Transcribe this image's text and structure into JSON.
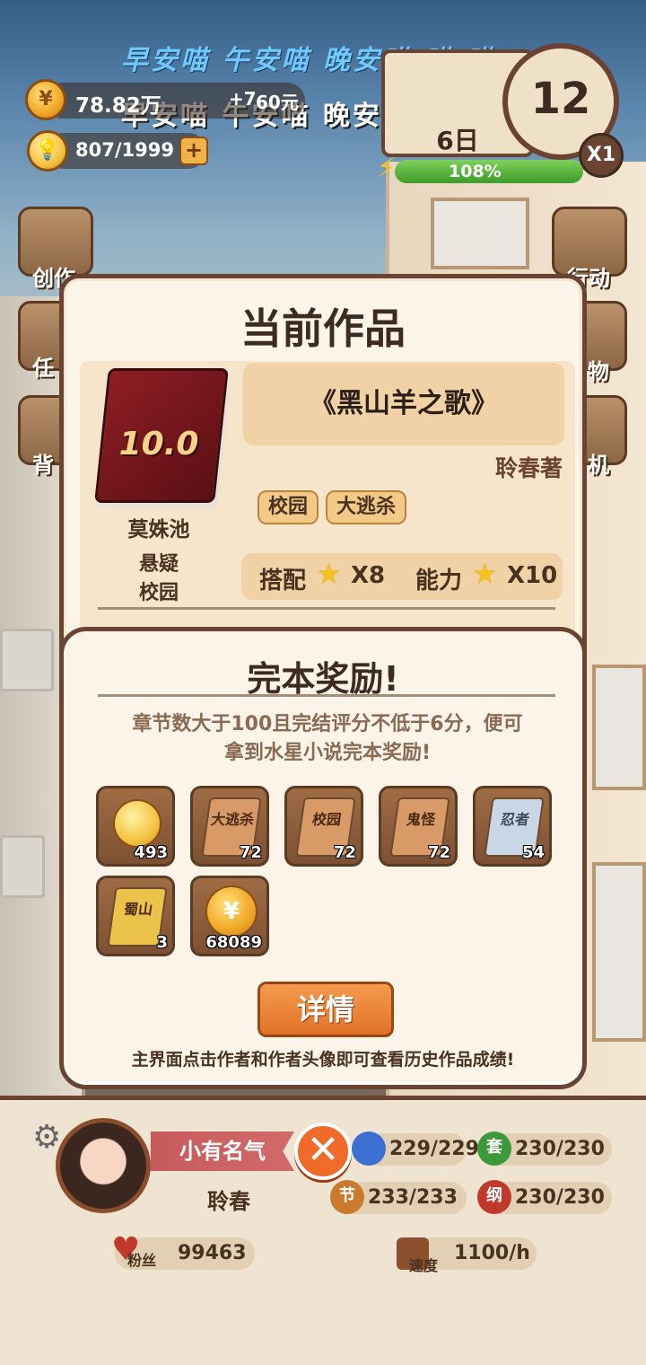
{
  "overlay": {
    "line1": "早安喵 午安喵 晚安喵 喵 喵",
    "line2": "早安喵 午安喵 晚安喵 喵 喵"
  },
  "hud": {
    "coins": "78.82万",
    "coins_extra": "+7",
    "coins_rate": "60元",
    "ideas": "807/1999",
    "day": "6日",
    "time_big": "12",
    "speed": "X1",
    "energy": "108%",
    "energy_fraction": 1.08
  },
  "side_left": [
    "创作",
    "任",
    "背"
  ],
  "side_right": [
    "行动",
    "物",
    "机"
  ],
  "current_work": {
    "panel_title": "当前作品",
    "book_score": "10.0",
    "book_title": "《黑山羊之歌》",
    "author": "聆春著",
    "tags": [
      "校园",
      "大逃杀"
    ],
    "platform": "莫姝池",
    "genre_lines": [
      "悬疑",
      "校园"
    ],
    "match_label": "搭配",
    "match_value": "X8",
    "ability_label": "能力",
    "ability_value": "X10"
  },
  "reward": {
    "title": "完本奖励!",
    "desc_line1": "章节数大于100且完结评分不低于6分，便可",
    "desc_line2": "拿到水星小说完本奖励!",
    "items": [
      {
        "icon": "lightbulb-icon",
        "label": "",
        "count": "493"
      },
      {
        "icon": "book-icon",
        "label": "大逃杀",
        "count": "72"
      },
      {
        "icon": "book-icon",
        "label": "校园",
        "count": "72"
      },
      {
        "icon": "book-icon",
        "label": "鬼怪",
        "count": "72"
      },
      {
        "icon": "book-icon",
        "label": "忍者",
        "count": "54"
      },
      {
        "icon": "book-icon",
        "label": "蜀山",
        "count": "3"
      },
      {
        "icon": "coin-icon",
        "label": "",
        "count": "68089"
      }
    ],
    "detail_button": "详情",
    "tip": "主界面点击作者和作者头像即可查看历史作品成绩!"
  },
  "profile": {
    "fame_title": "小有名气",
    "name": "聆春",
    "fans_label": "粉丝",
    "fans_value": "99463",
    "speed_label": "速度",
    "speed_value": "1100/h",
    "stats": [
      {
        "icon_text": "",
        "value": "229/229",
        "color": "#3b6fd1"
      },
      {
        "icon_text": "套",
        "value": "230/230",
        "color": "#3c9a3a"
      },
      {
        "icon_text": "节",
        "value": "233/233",
        "color": "#c97a2c"
      },
      {
        "icon_text": "纲",
        "value": "230/230",
        "color": "#c0392b"
      }
    ]
  },
  "colors": {
    "accent": "#e27228",
    "panel": "#fcf4e8",
    "border": "#6a4332"
  }
}
